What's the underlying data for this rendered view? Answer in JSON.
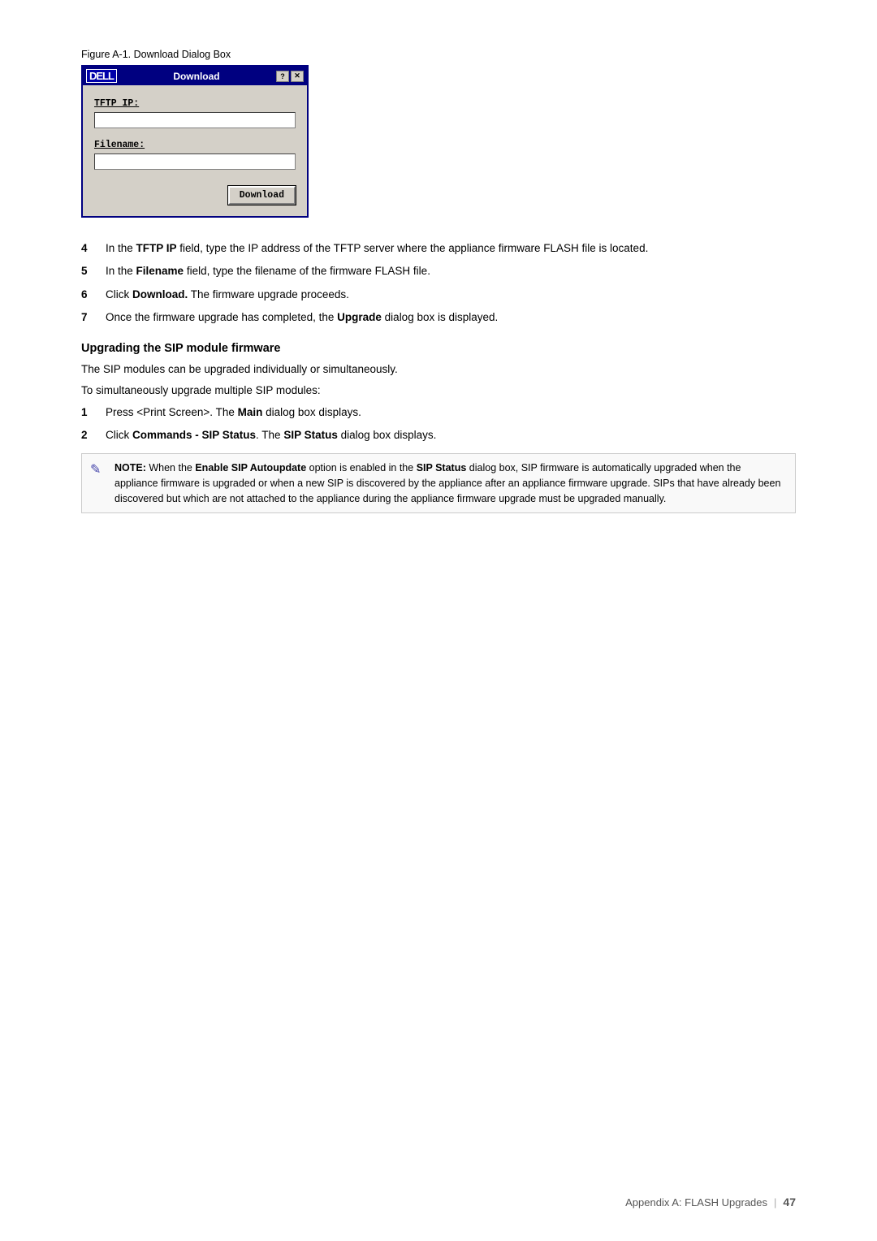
{
  "figure": {
    "caption_label": "Figure A-1.",
    "caption_text": "Download Dialog Box",
    "dialog": {
      "logo": "DELL",
      "title": "Download",
      "controls": [
        "?",
        "X"
      ],
      "fields": [
        {
          "label": "TFTP IP:",
          "value": ""
        },
        {
          "label": "Filename:",
          "value": ""
        }
      ],
      "button_label": "Download"
    }
  },
  "steps_section1": {
    "items": [
      {
        "num": "4",
        "text": "In the TFTP IP field, type the IP address of the TFTP server where the appliance firmware FLASH file is located."
      },
      {
        "num": "5",
        "text": "In the Filename field, type the filename of the firmware FLASH file."
      },
      {
        "num": "6",
        "text": "Click Download. The firmware upgrade proceeds."
      },
      {
        "num": "7",
        "text": "Once the firmware upgrade has completed, the Upgrade dialog box is displayed."
      }
    ]
  },
  "section_heading": "Upgrading the SIP module firmware",
  "paragraphs": [
    "The SIP modules can be upgraded individually or simultaneously.",
    "To simultaneously upgrade multiple SIP modules:"
  ],
  "steps_section2": {
    "items": [
      {
        "num": "1",
        "text": "Press <Print Screen>. The Main dialog box displays."
      },
      {
        "num": "2",
        "text": "Click Commands - SIP Status. The SIP Status dialog box displays."
      }
    ]
  },
  "note": {
    "icon": "✎",
    "label": "NOTE:",
    "text": "When the Enable SIP Autoupdate option is enabled in the SIP Status dialog box, SIP firmware is automatically upgraded when the appliance firmware is upgraded or when a new SIP is discovered by the appliance after an appliance firmware upgrade. SIPs that have already been discovered but which are not attached to the appliance during the appliance firmware upgrade must be upgraded manually."
  },
  "footer": {
    "appendix_text": "Appendix A: FLASH Upgrades",
    "divider": "|",
    "page_num": "47"
  }
}
